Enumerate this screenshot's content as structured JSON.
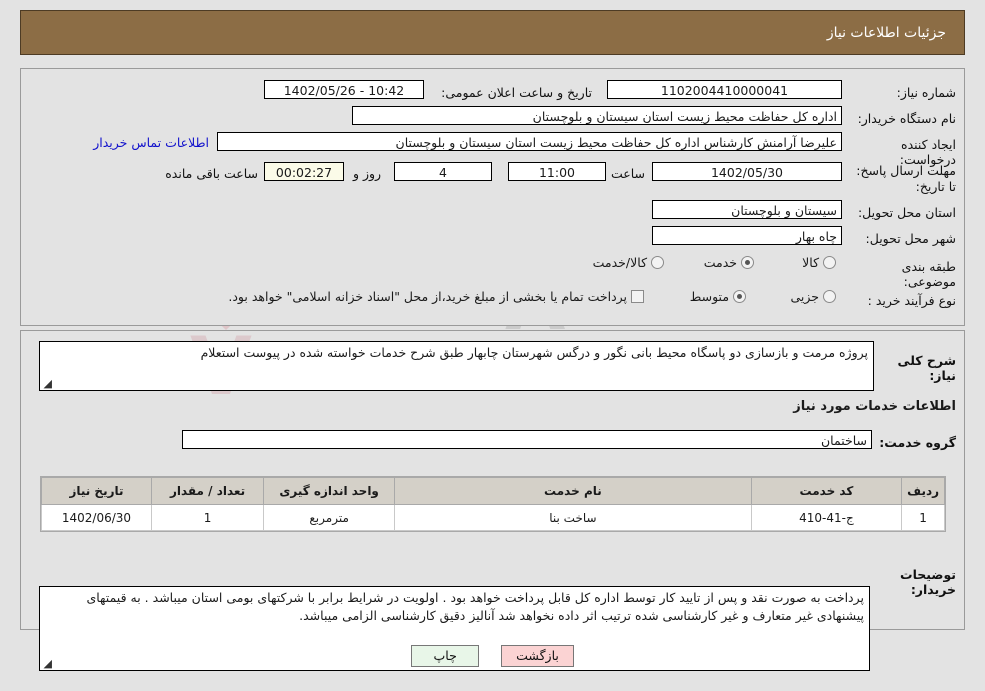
{
  "header": {
    "title": "جزئیات اطلاعات نیاز"
  },
  "info": {
    "need_number_label": "شماره نیاز:",
    "need_number_value": "1102004410000041",
    "announce_label": "تاریخ و ساعت اعلان عمومی:",
    "announce_value": "10:42 - 1402/05/26",
    "buyer_org_label": "نام دستگاه خریدار:",
    "buyer_org_value": "اداره کل حفاظت محیط زیست استان سیستان و بلوچستان",
    "creator_label": "ایجاد کننده درخواست:",
    "creator_value": "علیرضا آرامنش کارشناس اداره کل حفاظت محیط زیست استان سیستان و بلوچستان",
    "contact_link": "اطلاعات تماس خریدار",
    "deadline_label": "مهلت ارسال پاسخ: تا تاریخ:",
    "deadline_date": "1402/05/30",
    "hour_label": "ساعت",
    "deadline_time": "11:00",
    "days_remaining": "4",
    "days_label": "روز و",
    "time_remaining": "00:02:27",
    "remaining_label": "ساعت باقی مانده",
    "province_label": "استان محل تحویل:",
    "province_value": "سیستان و بلوچستان",
    "city_label": "شهر محل تحویل:",
    "city_value": "چاه بهار",
    "category_label": "طبقه بندی موضوعی:",
    "category_options": [
      "کالا",
      "خدمت",
      "کالا/خدمت"
    ],
    "category_selected": "خدمت",
    "process_label": "نوع فرآیند خرید :",
    "process_options": [
      "جزیی",
      "متوسط"
    ],
    "process_selected": "متوسط",
    "treasury_checkbox_label": "پرداخت تمام یا بخشی از مبلغ خرید،از محل \"اسناد خزانه اسلامی\" خواهد بود.",
    "treasury_checked": false
  },
  "description": {
    "label": "شرح کلی نیاز:",
    "value": "پروژه مرمت و بازسازی دو پاسگاه محیط بانی نگور و درگس شهرستان چابهار طبق شرح خدمات خواسته شده در پیوست استعلام"
  },
  "services": {
    "section_title": "اطلاعات خدمات مورد نیاز",
    "group_label": "گروه خدمت:",
    "group_value": "ساختمان",
    "columns": [
      "ردیف",
      "کد خدمت",
      "نام خدمت",
      "واحد اندازه گیری",
      "تعداد / مقدار",
      "تاریخ نیاز"
    ],
    "rows": [
      {
        "row": "1",
        "code": "ج-41-410",
        "name": "ساخت بنا",
        "unit": "مترمربع",
        "qty": "1",
        "date": "1402/06/30"
      }
    ]
  },
  "buyer_notes": {
    "label": "توضیحات خریدار:",
    "value": "پرداخت به صورت نقد و پس از تایید کار توسط اداره کل قابل پرداخت خواهد بود . اولویت در شرایط برابر با شرکتهای بومی استان میباشد . به قیمتهای پیشنهادی غیر متعارف و غیر کارشناسی شده ترتیب اثر داده نخواهد شد آنالیز دقیق کارشناسی الزامی میباشد."
  },
  "buttons": {
    "print": "چاپ",
    "back": "بازگشت"
  },
  "watermark": {
    "text": "naTender.net",
    "letter_v": "V",
    "letter_a": "A"
  }
}
